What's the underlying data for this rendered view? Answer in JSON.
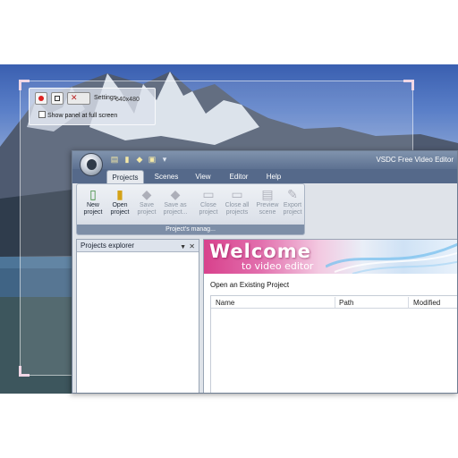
{
  "recorder": {
    "settings_label": "Settings",
    "resolution": "640x480",
    "fullscreen_label": "Show panel at full screen",
    "record_icon": "record-icon",
    "stop_icon": "stop-icon"
  },
  "app": {
    "window_title": "VSDC Free Video Editor",
    "tabs": [
      "Projects",
      "Scenes",
      "View",
      "Editor",
      "Help"
    ],
    "ribbon": {
      "buttons": [
        {
          "line1": "New",
          "line2": "project",
          "icon": "new-project-icon",
          "enabled": true
        },
        {
          "line1": "Open",
          "line2": "project",
          "icon": "open-project-icon",
          "enabled": true
        },
        {
          "line1": "Save",
          "line2": "project",
          "icon": "save-project-icon",
          "enabled": false
        },
        {
          "line1": "Save as",
          "line2": "project...",
          "icon": "save-as-icon",
          "enabled": false
        },
        {
          "line1": "Close",
          "line2": "project",
          "icon": "close-project-icon",
          "enabled": false
        },
        {
          "line1": "Close all",
          "line2": "projects",
          "icon": "close-all-icon",
          "enabled": false
        },
        {
          "line1": "Preview",
          "line2": "scene",
          "icon": "preview-icon",
          "enabled": false
        },
        {
          "line1": "Export",
          "line2": "project",
          "icon": "export-icon",
          "enabled": false
        }
      ],
      "group_label": "Project's manag..."
    },
    "explorer": {
      "title": "Projects explorer"
    },
    "welcome": {
      "title": "Welcome",
      "subtitle": "to video editor",
      "open_existing": "Open an Existing Project",
      "columns": [
        "Name",
        "Path",
        "Modified"
      ]
    }
  },
  "colors": {
    "accent": "#d8418c",
    "titlebar": "#5d7191",
    "menubar": "#55698a"
  }
}
